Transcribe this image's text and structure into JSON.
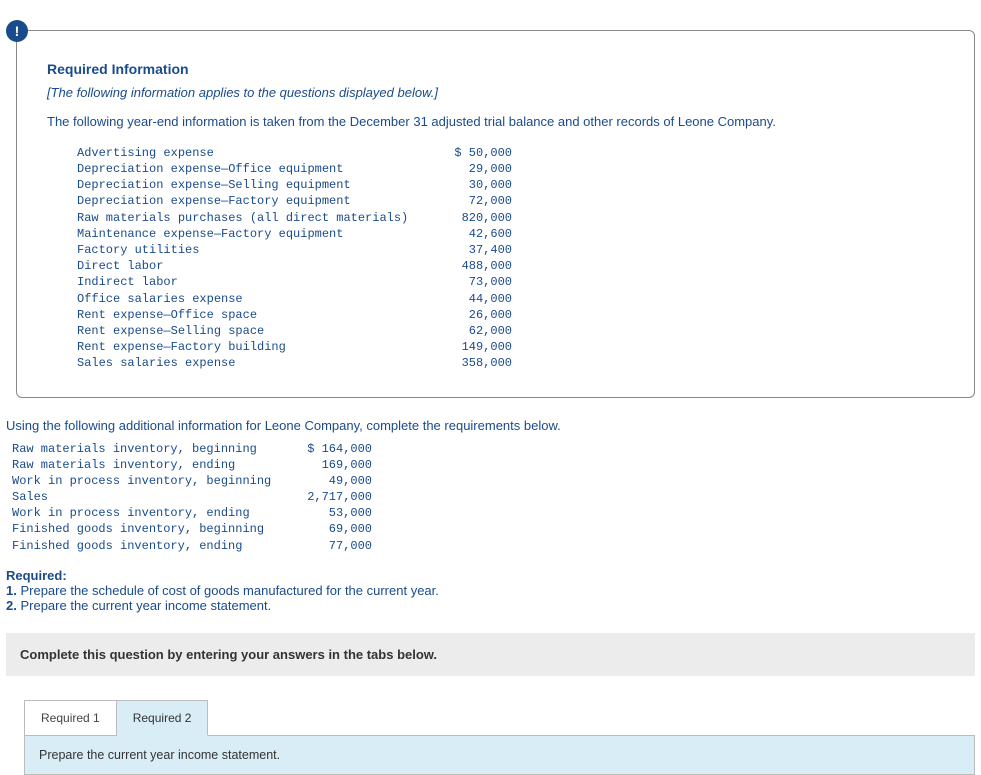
{
  "info_icon_char": "!",
  "box": {
    "heading": "Required Information",
    "note": "[The following information applies to the questions displayed below.]",
    "narrative": "The following year-end information is taken from the December 31 adjusted trial balance and other records of Leone Company.",
    "rows": [
      {
        "label": "Advertising expense",
        "value": "$ 50,000"
      },
      {
        "label": "Depreciation expense—Office equipment",
        "value": "29,000"
      },
      {
        "label": "Depreciation expense—Selling equipment",
        "value": "30,000"
      },
      {
        "label": "Depreciation expense—Factory equipment",
        "value": "72,000"
      },
      {
        "label": "Raw materials purchases (all direct materials)",
        "value": "820,000"
      },
      {
        "label": "Maintenance expense—Factory equipment",
        "value": "42,600"
      },
      {
        "label": "Factory utilities",
        "value": "37,400"
      },
      {
        "label": "Direct labor",
        "value": "488,000"
      },
      {
        "label": "Indirect labor",
        "value": "73,000"
      },
      {
        "label": "Office salaries expense",
        "value": "44,000"
      },
      {
        "label": "Rent expense—Office space",
        "value": "26,000"
      },
      {
        "label": "Rent expense—Selling space",
        "value": "62,000"
      },
      {
        "label": "Rent expense—Factory building",
        "value": "149,000"
      },
      {
        "label": "Sales salaries expense",
        "value": "358,000"
      }
    ]
  },
  "additional": {
    "intro": "Using the following additional information for Leone Company, complete the requirements below.",
    "rows": [
      {
        "label": "Raw materials inventory, beginning",
        "value": "$ 164,000"
      },
      {
        "label": "Raw materials inventory, ending",
        "value": "169,000"
      },
      {
        "label": "Work in process inventory, beginning",
        "value": "49,000"
      },
      {
        "label": "Sales",
        "value": "2,717,000"
      },
      {
        "label": "Work in process inventory, ending",
        "value": "53,000"
      },
      {
        "label": "Finished goods inventory, beginning",
        "value": "69,000"
      },
      {
        "label": "Finished goods inventory, ending",
        "value": "77,000"
      }
    ]
  },
  "required": {
    "title": "Required:",
    "item1_num": "1. ",
    "item1": "Prepare the schedule of cost of goods manufactured for the current year.",
    "item2_num": "2. ",
    "item2": "Prepare the current year income statement."
  },
  "complete_bar": "Complete this question by entering your answers in the tabs below.",
  "tabs": {
    "t1": "Required 1",
    "t2": "Required 2",
    "content": "Prepare the current year income statement."
  }
}
